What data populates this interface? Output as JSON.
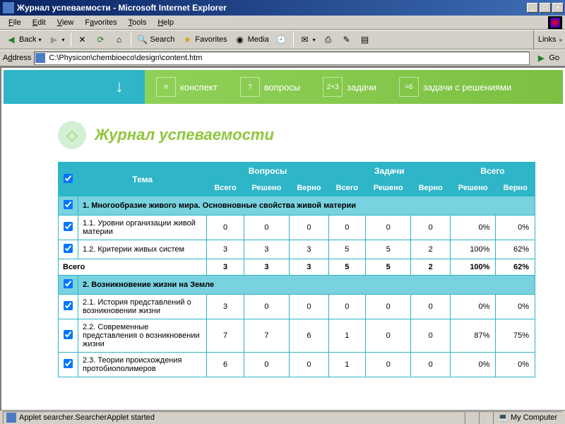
{
  "window": {
    "title": "Журнал успеваемости - Microsoft Internet Explorer",
    "min": "_",
    "max": "□",
    "close": "×"
  },
  "menu": {
    "file": "File",
    "edit": "Edit",
    "view": "View",
    "favorites": "Favorites",
    "tools": "Tools",
    "help": "Help"
  },
  "toolbar": {
    "back": "Back",
    "search": "Search",
    "favorites": "Favorites",
    "media": "Media",
    "links": "Links"
  },
  "address": {
    "label": "Address",
    "value": "C:\\Physicon\\chembioeco\\design\\content.htm",
    "go": "Go"
  },
  "app_tabs": {
    "konspekt": "конспект",
    "voprosy": "вопросы",
    "zadachi": "задачи",
    "zadachi_resh": "задачи с решениями"
  },
  "page": {
    "title": "Журнал успеваемости"
  },
  "table": {
    "headers": {
      "tema": "Тема",
      "voprosy": "Вопросы",
      "zadachi": "Задачи",
      "vsego_grp": "Всего",
      "vsego": "Всего",
      "resheno": "Решено",
      "verno": "Верно"
    },
    "section1": {
      "title": "1. Многообразие живого мира. Основновные свойства живой материи"
    },
    "r1_1": {
      "topic": "1.1. Уровни организации живой материи",
      "qt": "0",
      "qs": "0",
      "qc": "0",
      "tt": "0",
      "ts": "0",
      "tc": "0",
      "ps": "0%",
      "pc": "0%"
    },
    "r1_2": {
      "topic": "1.2. Критерии живых систем",
      "qt": "3",
      "qs": "3",
      "qc": "3",
      "tt": "5",
      "ts": "5",
      "tc": "2",
      "ps": "100%",
      "pc": "62%"
    },
    "total1": {
      "label": "Всего",
      "qt": "3",
      "qs": "3",
      "qc": "3",
      "tt": "5",
      "ts": "5",
      "tc": "2",
      "ps": "100%",
      "pc": "62%"
    },
    "section2": {
      "title": "2. Возникновение жизни на Земле"
    },
    "r2_1": {
      "topic": "2.1. История представлений о возникновении жизни",
      "qt": "3",
      "qs": "0",
      "qc": "0",
      "tt": "0",
      "ts": "0",
      "tc": "0",
      "ps": "0%",
      "pc": "0%"
    },
    "r2_2": {
      "topic": "2.2. Современные представления о возникновении жизни",
      "qt": "7",
      "qs": "7",
      "qc": "6",
      "tt": "1",
      "ts": "0",
      "tc": "0",
      "ps": "87%",
      "pc": "75%"
    },
    "r2_3": {
      "topic": "2.3. Теории происхождения протобиополимеров",
      "qt": "6",
      "qs": "0",
      "qc": "0",
      "tt": "1",
      "ts": "0",
      "tc": "0",
      "ps": "0%",
      "pc": "0%"
    }
  },
  "status": {
    "text": "Applet searcher.SearcherApplet started",
    "zone": "My Computer"
  }
}
